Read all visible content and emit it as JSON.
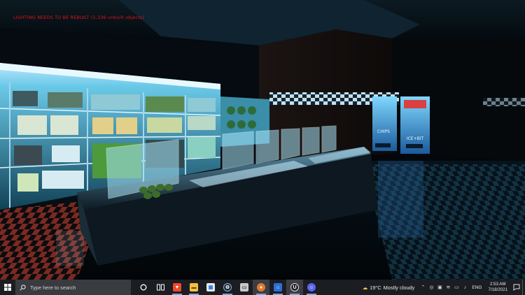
{
  "game": {
    "warning_text": "LIGHTING NEEDS TO BE REBUILT (1,336 unbuilt objects)",
    "sign_left": "CHIPS",
    "sign_right": "ICE+BIT"
  },
  "taskbar": {
    "search_placeholder": "Type here to search",
    "apps": [
      {
        "name": "task-view",
        "icon": "task-view-icon"
      },
      {
        "name": "brave",
        "icon": "brave-icon"
      },
      {
        "name": "file-explorer",
        "icon": "folder-icon"
      },
      {
        "name": "microsoft-store",
        "icon": "store-icon"
      },
      {
        "name": "steam",
        "icon": "steam-icon"
      },
      {
        "name": "app-6",
        "icon": "window-icon"
      },
      {
        "name": "app-7",
        "icon": "avatar-icon"
      },
      {
        "name": "home",
        "icon": "home-icon"
      },
      {
        "name": "unreal-engine",
        "icon": "unreal-icon"
      },
      {
        "name": "discord",
        "icon": "discord-icon"
      }
    ],
    "weather": {
      "temp": "19°C",
      "condition": "Mostly cloudy"
    },
    "language": "ENG",
    "time": "2:53 AM",
    "date": "7/18/2021"
  },
  "colors": {
    "accent": "#7aa6d8",
    "warning": "#e0141a",
    "taskbar": "#1b1d22"
  }
}
